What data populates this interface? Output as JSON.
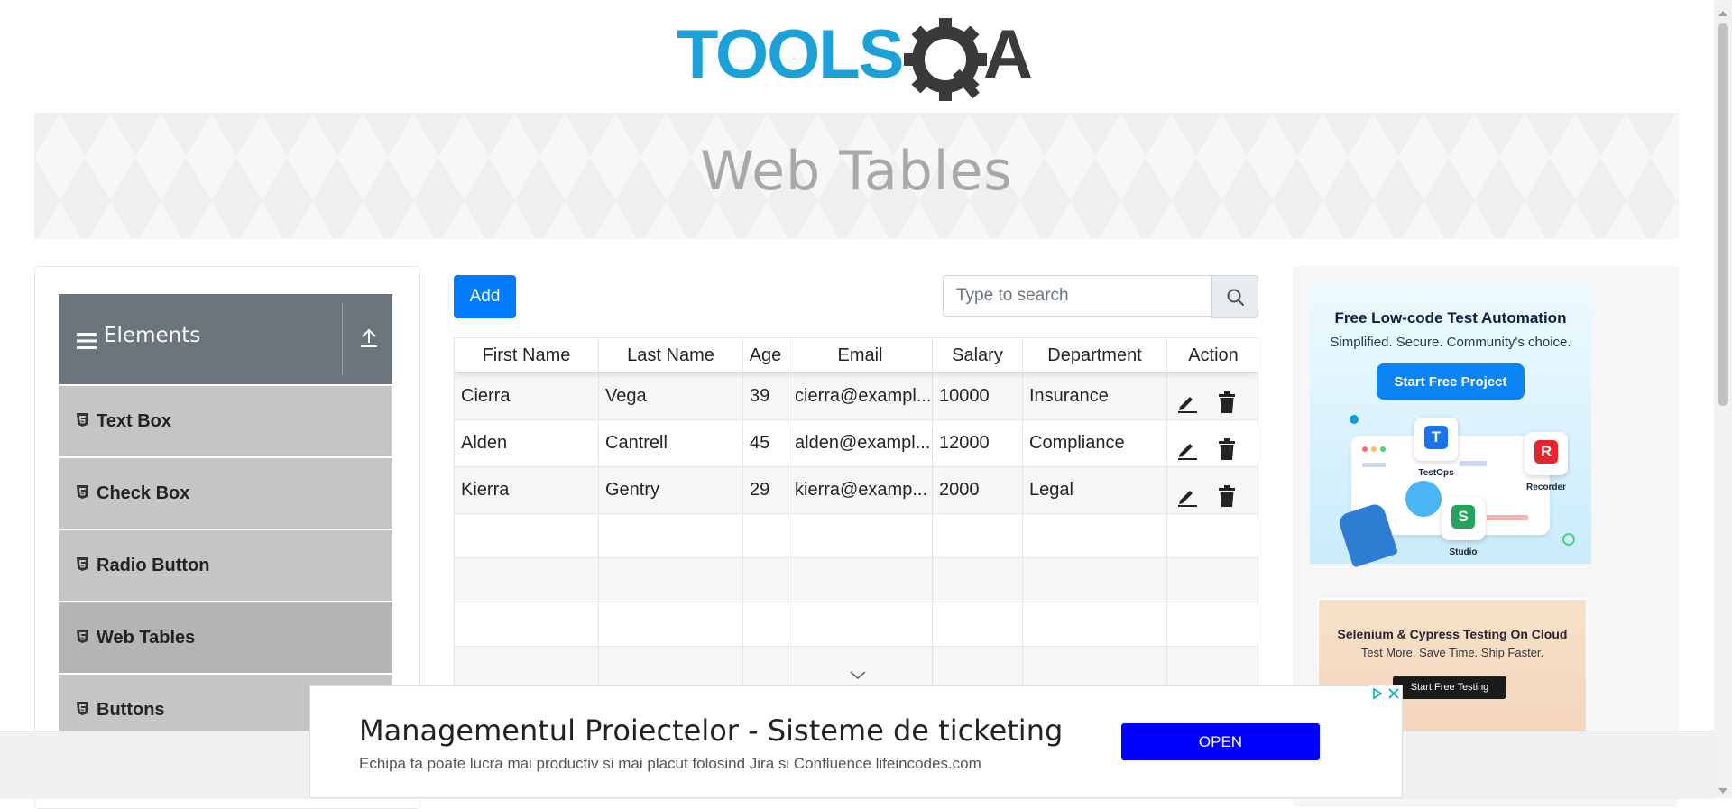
{
  "header": {
    "logo_text_left": "TOOLS",
    "logo_text_right": "A",
    "logo_color_blue": "#1ba1d8",
    "logo_color_dark": "#3a3a3a"
  },
  "banner": {
    "title": "Web Tables"
  },
  "sidebar": {
    "group_title": "Elements",
    "group_icon": "hamburger-icon",
    "collapse_icon": "upload-arrow-icon",
    "items": [
      {
        "label": "Text Box",
        "icon": "html5-icon"
      },
      {
        "label": "Check Box",
        "icon": "html5-icon"
      },
      {
        "label": "Radio Button",
        "icon": "html5-icon"
      },
      {
        "label": "Web Tables",
        "icon": "html5-icon",
        "active": true
      },
      {
        "label": "Buttons",
        "icon": "html5-icon"
      }
    ]
  },
  "toolbar": {
    "add_label": "Add",
    "search_placeholder": "Type to search",
    "search_icon": "search-icon"
  },
  "table": {
    "columns": [
      "First Name",
      "Last Name",
      "Age",
      "Email",
      "Salary",
      "Department",
      "Action"
    ],
    "rows": [
      {
        "first": "Cierra",
        "last": "Vega",
        "age": "39",
        "email": "cierra@exampl...",
        "salary": "10000",
        "department": "Insurance"
      },
      {
        "first": "Alden",
        "last": "Cantrell",
        "age": "45",
        "email": "alden@exampl...",
        "salary": "12000",
        "department": "Compliance"
      },
      {
        "first": "Kierra",
        "last": "Gentry",
        "age": "29",
        "email": "kierra@examp...",
        "salary": "2000",
        "department": "Legal"
      }
    ],
    "action_icons": [
      "edit-pencil-icon",
      "trash-icon"
    ]
  },
  "ads": {
    "ad1": {
      "title": "Free Low-code Test Automation",
      "subtitle": "Simplified. Secure. Community's choice.",
      "button": "Start Free Project",
      "badges": [
        {
          "letter": "T",
          "label": "TestOps",
          "color": "#1a73e8"
        },
        {
          "letter": "R",
          "label": "Recorder",
          "color": "#e5242f"
        },
        {
          "letter": "S",
          "label": "Studio",
          "color": "#22a45d"
        }
      ]
    },
    "ad2": {
      "title": "Selenium & Cypress Testing On Cloud",
      "subtitle": "Test More. Save Time. Ship Faster.",
      "button": "Start Free Testing"
    },
    "bottom": {
      "headline": "Managementul Proiectelor - Sisteme de ticketing",
      "description": "Echipa ta poate lucra mai productiv si mai placut folosind Jira si Confluence lifeincodes.com",
      "button": "OPEN",
      "button_color": "#0000ff"
    }
  },
  "colors": {
    "primary": "#007bff",
    "sidebar_header": "#6c757d",
    "sidebar_item": "#c5c5c5"
  }
}
